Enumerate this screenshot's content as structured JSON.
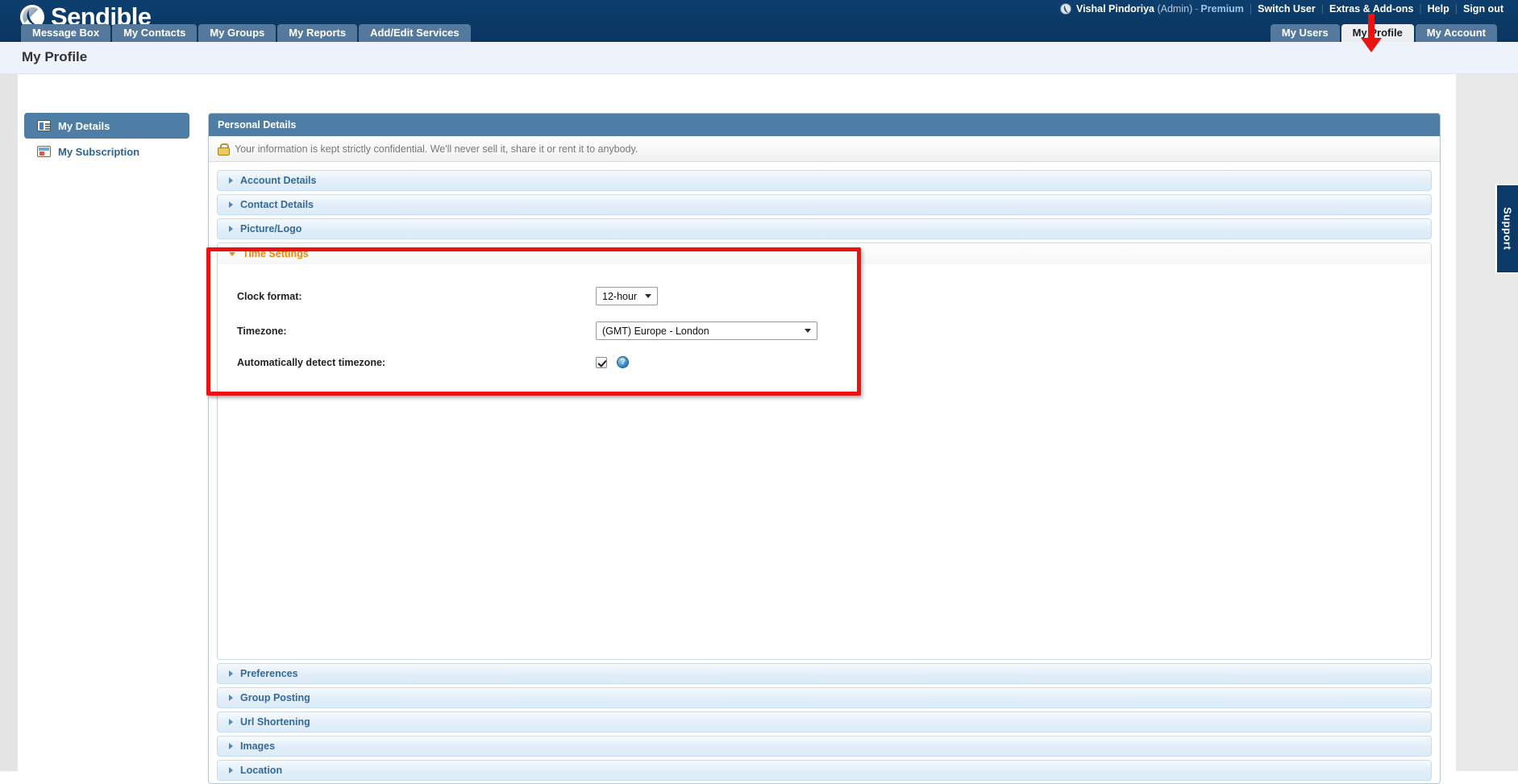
{
  "brand": {
    "name": "Sendible",
    "logo_icon": "sendible-logo-icon"
  },
  "utilnav": {
    "avatar_icon": "user-avatar-icon",
    "user_name": "Vishal Pindoriya",
    "user_role": "(Admin)",
    "dash": "-",
    "plan": "Premium",
    "sep": "|",
    "links": [
      {
        "label": "Switch User"
      },
      {
        "label": "Extras & Add-ons"
      },
      {
        "label": "Help"
      },
      {
        "label": "Sign out"
      }
    ]
  },
  "tabs_left": [
    {
      "label": "Message Box",
      "active": false
    },
    {
      "label": "My Contacts",
      "active": false
    },
    {
      "label": "My Groups",
      "active": false
    },
    {
      "label": "My Reports",
      "active": false
    },
    {
      "label": "Add/Edit Services",
      "active": false
    }
  ],
  "tabs_right": [
    {
      "label": "My Users",
      "active": false
    },
    {
      "label": "My Profile",
      "active": true
    },
    {
      "label": "My Account",
      "active": false
    }
  ],
  "page": {
    "title": "My Profile"
  },
  "sidebar": {
    "items": [
      {
        "label": "My Details",
        "icon": "details-card-icon",
        "active": true
      },
      {
        "label": "My Subscription",
        "icon": "subscription-card-icon",
        "active": false
      }
    ]
  },
  "panel": {
    "header": "Personal Details",
    "notice_icon": "lock-icon",
    "notice": "Your information is kept strictly confidential. We'll never sell it, share it or rent it to anybody."
  },
  "sections_top": [
    {
      "label": "Account Details"
    },
    {
      "label": "Contact Details"
    },
    {
      "label": "Picture/Logo"
    }
  ],
  "time_settings": {
    "label": "Time Settings",
    "expanded": true,
    "clock_format": {
      "label": "Clock format:",
      "value": "12-hour"
    },
    "timezone": {
      "label": "Timezone:",
      "value": "(GMT) Europe - London"
    },
    "auto_detect": {
      "label": "Automatically detect timezone:",
      "checked": true,
      "help_glyph": "?"
    }
  },
  "sections_bottom": [
    {
      "label": "Preferences"
    },
    {
      "label": "Group Posting"
    },
    {
      "label": "Url Shortening"
    },
    {
      "label": "Images"
    },
    {
      "label": "Location"
    }
  ],
  "support": {
    "label": "Support"
  },
  "annotations": {
    "arrow_color": "#ee1111",
    "highlight_color": "#ee1111",
    "arrow_target": "My Profile",
    "highlight_target": "Time Settings"
  }
}
